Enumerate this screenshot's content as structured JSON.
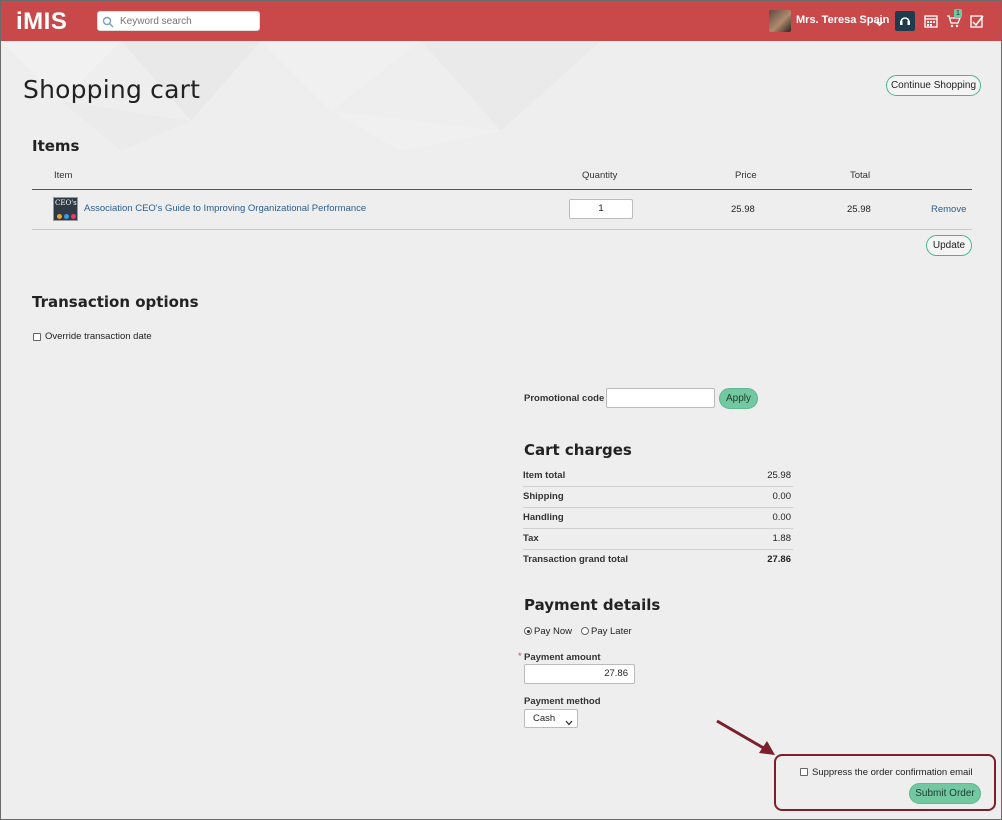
{
  "header": {
    "logo": "iMIS",
    "search_placeholder": "Keyword search",
    "user_name": "Mrs. Teresa Spain",
    "cart_badge": "1"
  },
  "page": {
    "title": "Shopping cart",
    "continue_shopping": "Continue Shopping"
  },
  "items_section": {
    "title": "Items",
    "columns": [
      "Item",
      "Quantity",
      "Price",
      "Total"
    ],
    "rows": [
      {
        "thumb_text": "CEO's",
        "name": "Association CEO's Guide to Improving Organizational Performance",
        "quantity": "1",
        "price": "25.98",
        "total": "25.98",
        "remove": "Remove"
      }
    ],
    "update": "Update"
  },
  "transaction_options": {
    "title": "Transaction options",
    "override_label": "Override transaction date"
  },
  "promo": {
    "label": "Promotional code",
    "value": "",
    "apply": "Apply"
  },
  "cart_charges": {
    "title": "Cart charges",
    "rows": [
      {
        "label": "Item total",
        "value": "25.98"
      },
      {
        "label": "Shipping",
        "value": "0.00"
      },
      {
        "label": "Handling",
        "value": "0.00"
      },
      {
        "label": "Tax",
        "value": "1.88"
      },
      {
        "label": "Transaction grand total",
        "value": "27.86"
      }
    ]
  },
  "payment": {
    "title": "Payment details",
    "pay_now": "Pay Now",
    "pay_later": "Pay Later",
    "amount_label": "Payment amount",
    "required_mark": "*",
    "amount_value": "27.86",
    "method_label": "Payment method",
    "method_value": "Cash"
  },
  "submit": {
    "suppress_label": "Suppress the order confirmation email",
    "submit_label": "Submit Order"
  },
  "colors": {
    "header": "#c9494a",
    "accent": "#71c8a1",
    "link": "#2d5f8a",
    "highlight": "#7a1f2b"
  }
}
